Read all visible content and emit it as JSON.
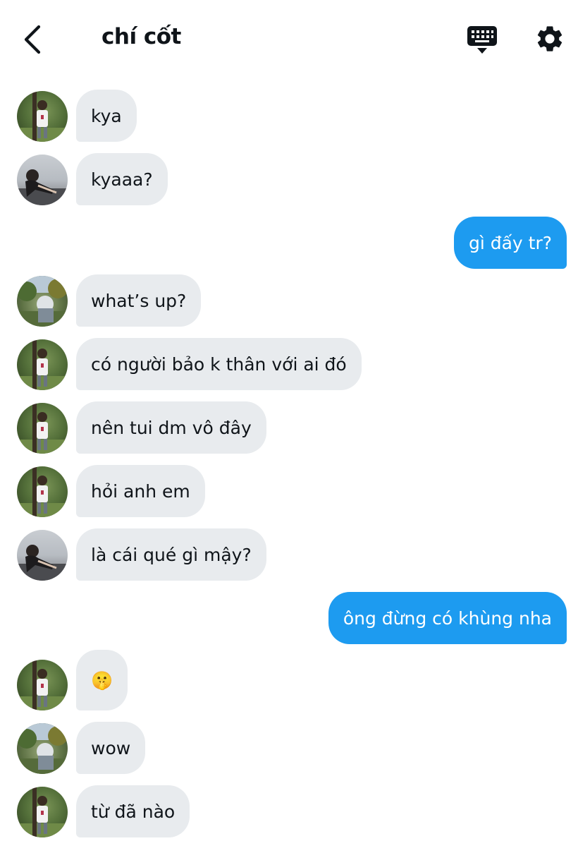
{
  "header": {
    "title": "chí cốt"
  },
  "colors": {
    "incoming_bubble": "#e8ebee",
    "outgoing_bubble": "#1d9bf0",
    "text": "#0f1419"
  },
  "icons": {
    "back": "chevron-left-icon",
    "keyboard": "keyboard-icon",
    "settings": "gear-icon"
  },
  "messages": [
    {
      "direction": "in",
      "avatar": "avatar-1",
      "text": "kya"
    },
    {
      "direction": "in",
      "avatar": "avatar-2",
      "text": "kyaaa?"
    },
    {
      "direction": "out",
      "text": "gì đấy tr?"
    },
    {
      "direction": "in",
      "avatar": "avatar-3",
      "text": "what’s up?"
    },
    {
      "direction": "in",
      "avatar": "avatar-1",
      "text": "có người bảo k thân với ai đó"
    },
    {
      "direction": "in",
      "avatar": "avatar-1",
      "text": "nên tui dm vô đây"
    },
    {
      "direction": "in",
      "avatar": "avatar-1",
      "text": "hỏi anh em"
    },
    {
      "direction": "in",
      "avatar": "avatar-2",
      "text": "là cái qué gì mậy?"
    },
    {
      "direction": "out",
      "text": "ông đừng có khùng nha"
    },
    {
      "direction": "in",
      "avatar": "avatar-1",
      "text": "🤫"
    },
    {
      "direction": "in",
      "avatar": "avatar-3",
      "text": "wow"
    },
    {
      "direction": "in",
      "avatar": "avatar-1",
      "text": "từ đã nào"
    }
  ]
}
